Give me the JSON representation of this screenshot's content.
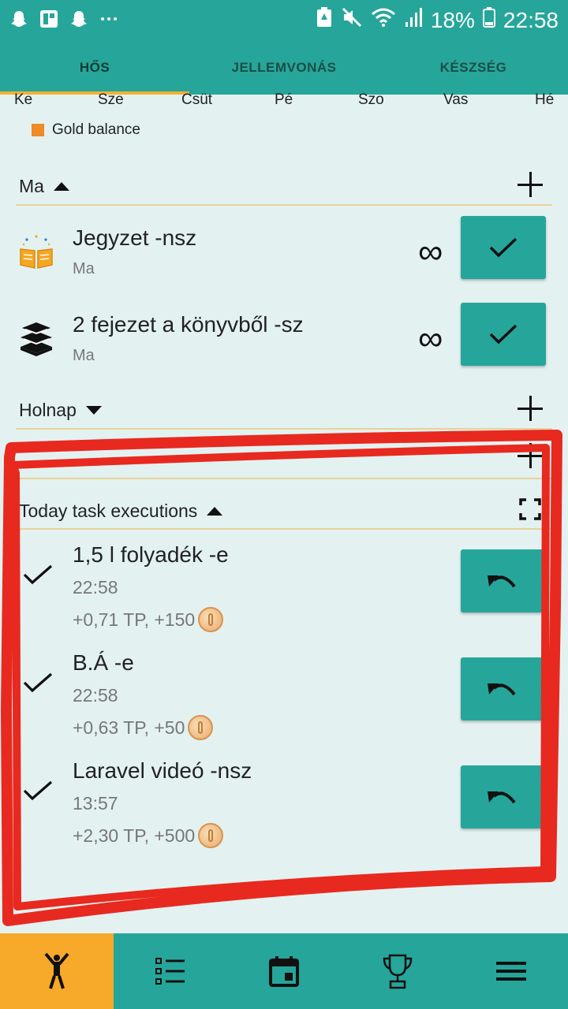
{
  "status_bar": {
    "battery": "18%",
    "time": "22:58",
    "icons": [
      "snapchat-icon",
      "flipboard-icon",
      "snapchat-icon",
      "more-icon",
      "battery-saver-icon",
      "mute-icon",
      "wifi-icon",
      "signal-icon",
      "battery-icon"
    ]
  },
  "tabs": [
    {
      "label": "HŐS",
      "active": true
    },
    {
      "label": "JELLEMVONÁS",
      "active": false
    },
    {
      "label": "KÉSZSÉG",
      "active": false
    }
  ],
  "days": [
    "Ke",
    "Sze",
    "Csüt",
    "Pé",
    "Szo",
    "Vas",
    "Hé"
  ],
  "legend": {
    "label": "Gold balance",
    "color": "#f08a24"
  },
  "sections": {
    "today": {
      "label": "Ma"
    },
    "tomorrow": {
      "label": "Holnap"
    },
    "executions": {
      "label": "Today task executions"
    }
  },
  "habits": [
    {
      "title": "Jegyzet -nsz",
      "sub": "Ma",
      "repeat": "∞",
      "icon": "open-book-icon"
    },
    {
      "title": "2 fejezet a könyvből -sz",
      "sub": "Ma",
      "repeat": "∞",
      "icon": "book-stack-icon"
    }
  ],
  "executions": [
    {
      "title": "1,5 l folyadék -e",
      "time": "22:58",
      "reward": "+0,71 TP, +150"
    },
    {
      "title": "B.Á -e",
      "time": "22:58",
      "reward": "+0,63 TP, +50"
    },
    {
      "title": "Laravel videó -nsz",
      "time": "13:57",
      "reward": "+2,30 TP, +500"
    }
  ],
  "bottom_nav": [
    "hero-icon",
    "task-list-icon",
    "calendar-icon",
    "trophy-icon",
    "menu-icon"
  ],
  "colors": {
    "primary": "#26a69a",
    "accent": "#f7a92a",
    "background": "#e3f2f1",
    "annotation": "#e8291f"
  }
}
